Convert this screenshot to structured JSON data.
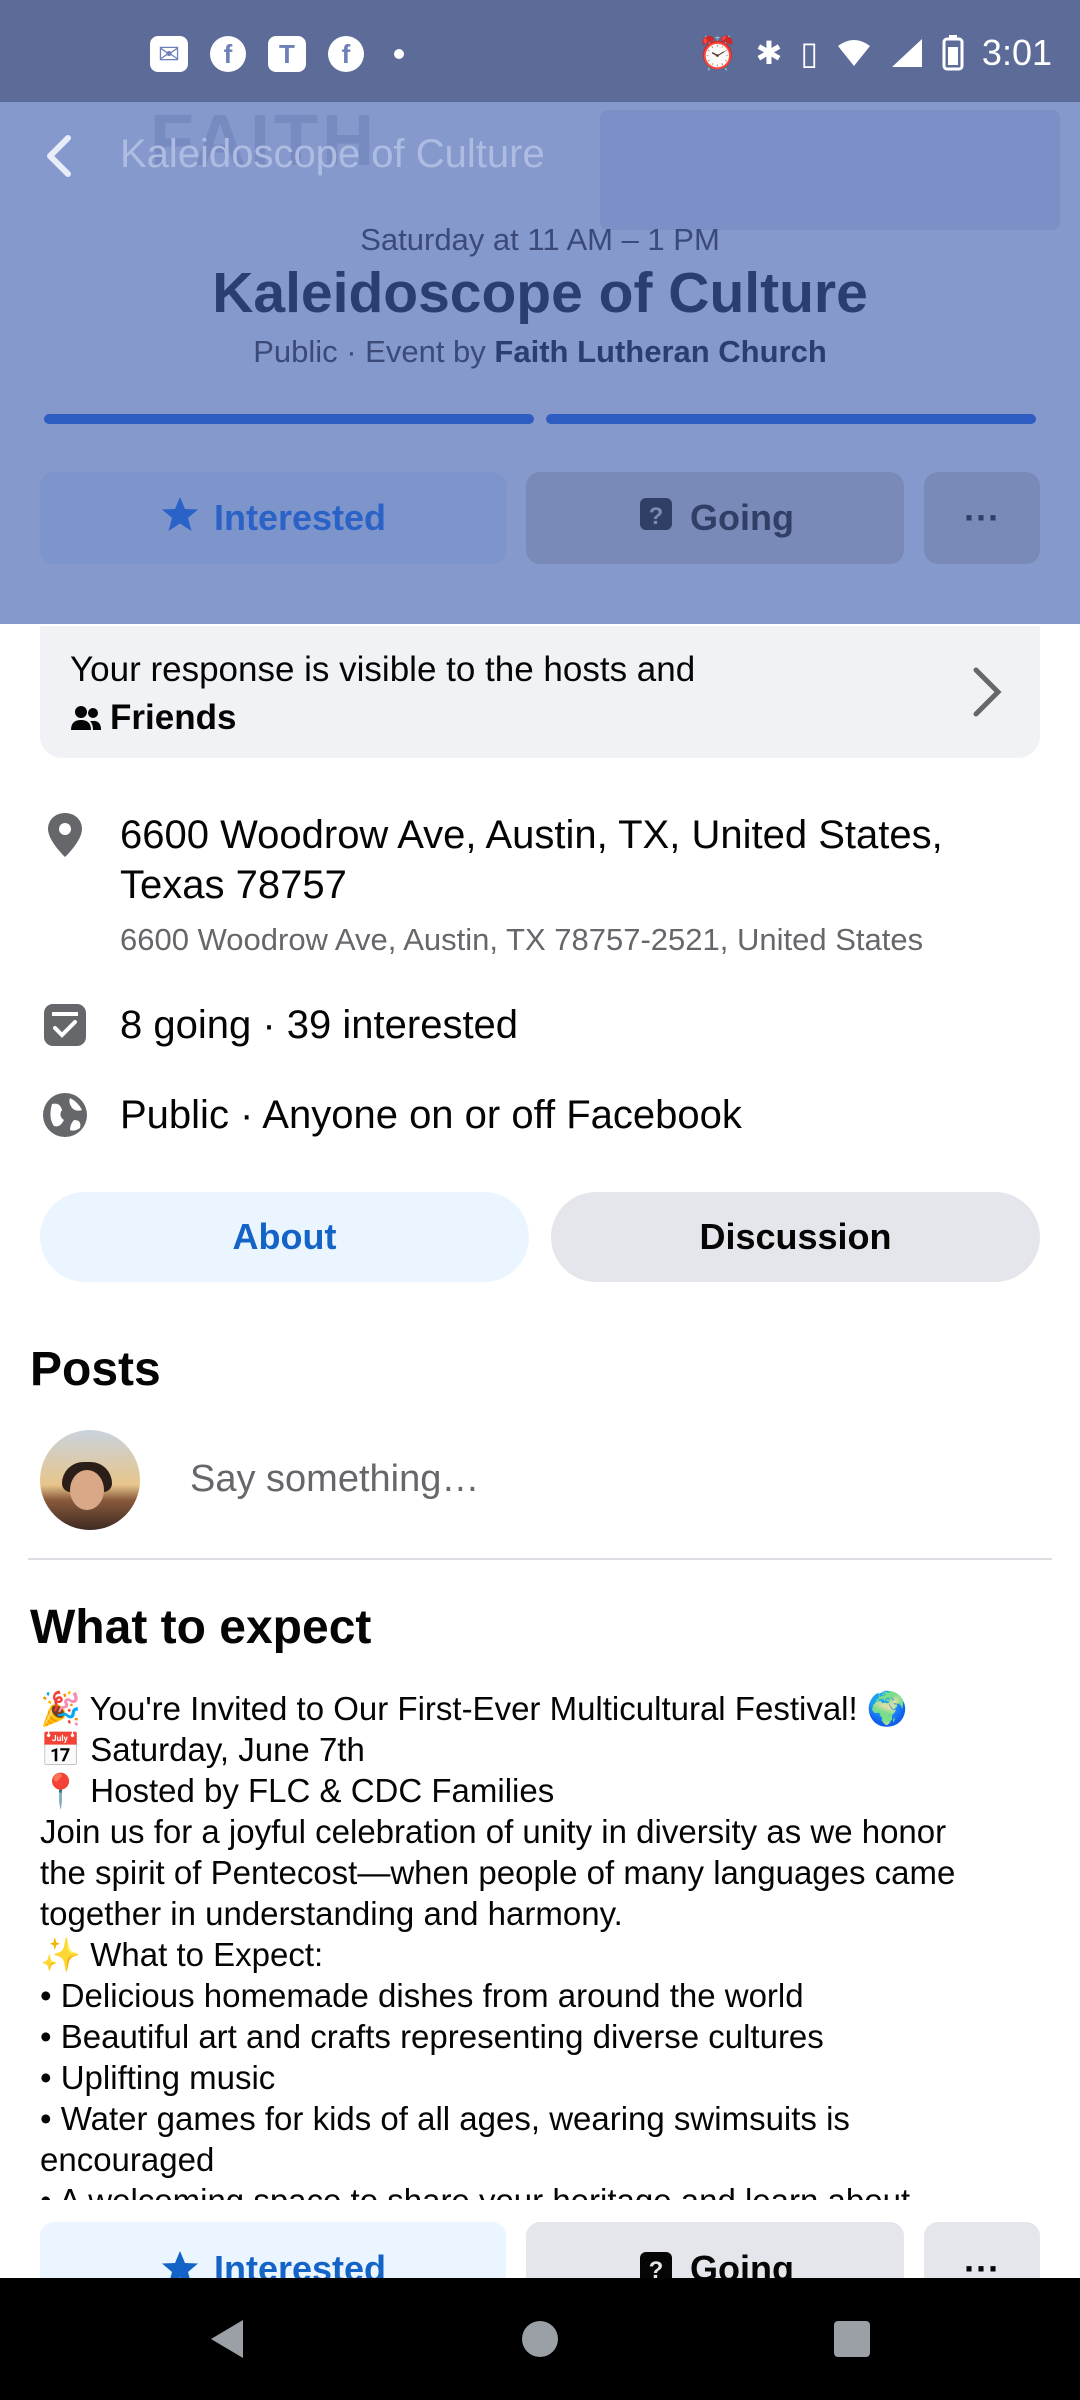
{
  "status_bar": {
    "left_icons": [
      "chat-bubble-icon",
      "facebook-icon",
      "teams-icon",
      "facebook-icon",
      "dot-icon"
    ],
    "right_icons": [
      "alarm-icon",
      "bluetooth-icon",
      "vibrate-icon",
      "wifi-icon",
      "signal-icon",
      "battery-icon"
    ],
    "time": "3:01"
  },
  "header": {
    "title": "Kaleidoscope of Culture",
    "event_date": "Saturday at 11 AM – 1 PM",
    "event_title": "Kaleidoscope of Culture",
    "event_sub_prefix": "Public · Event by ",
    "event_host": "Faith Lutheran Church",
    "story_segments": 2
  },
  "actions": {
    "interested_label": "Interested",
    "going_label": "Going",
    "more_label": "···"
  },
  "response_card": {
    "line1": "Your response is visible to the hosts and",
    "line2": "Friends"
  },
  "location": {
    "line1": "6600 Woodrow Ave, Austin, TX, United States,",
    "line2": "Texas 78757",
    "sub": "6600 Woodrow Ave, Austin, TX 78757-2521, United States"
  },
  "attendance": "8 going · 39 interested",
  "privacy": "Public · Anyone on or off Facebook",
  "tabs": {
    "about": "About",
    "discussion": "Discussion"
  },
  "posts": {
    "heading": "Posts",
    "placeholder": "Say something…"
  },
  "what_to_expect": {
    "heading": "What to expect",
    "lines": [
      "🎉 You're Invited to Our First-Ever Multicultural Festival! 🌍",
      "📅 Saturday, June 7th",
      "📍 Hosted by FLC & CDC Families",
      "Join us for a joyful celebration of unity in diversity as we honor",
      "the spirit of Pentecost—when people of many languages came",
      "together in understanding and harmony.",
      "✨ What to Expect:",
      "• Delicious homemade dishes from around the world",
      "• Beautiful art and crafts representing diverse cultures",
      "• Uplifting music",
      "• Water games for kids of all ages, wearing swimsuits is",
      "encouraged",
      "• A welcoming space to share your heritage and learn about"
    ]
  },
  "colors": {
    "overlay": "#8599cd",
    "accent_blue": "#1464c8",
    "card_bg": "#f0f2f5"
  }
}
